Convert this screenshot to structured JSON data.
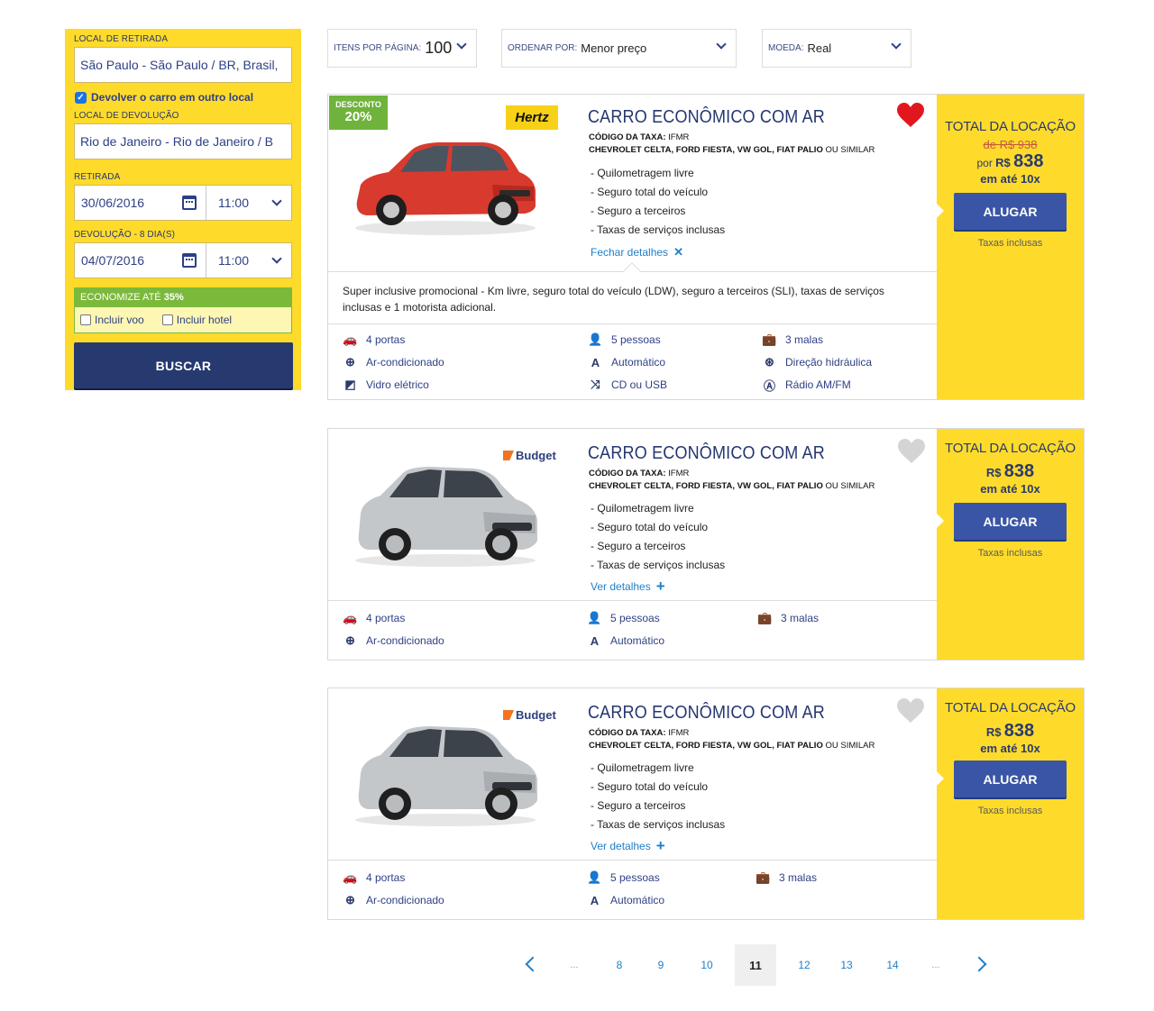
{
  "search": {
    "pickup_label": "LOCAL DE RETIRADA",
    "pickup_value": "São Paulo - São Paulo / BR, Brasil,",
    "return_other_label": "Devolver o carro em outro local",
    "return_label": "LOCAL DE DEVOLUÇÃO",
    "return_value": "Rio de Janeiro - Rio de Janeiro / B",
    "pickup_date_label": "RETIRADA",
    "pickup_date": "30/06/2016",
    "pickup_time": "11:00",
    "return_date_label": "DEVOLUÇÃO - 8 DIA(S)",
    "return_date": "04/07/2016",
    "return_time": "11:00",
    "economize_prefix": "ECONOMIZE ATÉ ",
    "economize_pct": "35%",
    "incluir_voo": "Incluir voo",
    "incluir_hotel": "Incluir hotel",
    "search_button": "BUSCAR"
  },
  "toolbar": {
    "per_page_label": "ITENS POR PÁGINA:",
    "per_page_value": "100",
    "sort_label": "ORDENAR POR:",
    "sort_value": "Menor preço",
    "currency_label": "MOEDA:",
    "currency_value": "Real"
  },
  "results": [
    {
      "company": "Hertz",
      "discount_label": "DESCONTO",
      "discount_value": "20%",
      "favorite": true,
      "title": "CARRO ECONÔMICO COM AR",
      "code_label": "CÓDIGO DA TAXA:",
      "code_value": "IFMR",
      "models": "CHEVROLET CELTA, FORD FIESTA, VW GOL, FIAT PALIO",
      "models_suffix": "OU SIMILAR",
      "features": [
        "- Quilometragem livre",
        "- Seguro total do veículo",
        "- Seguro a terceiros",
        "- Taxas de serviços inclusas"
      ],
      "details_link": "Fechar detalhes",
      "details_text": "Super inclusive promocional - Km livre, seguro total do veículo (LDW), seguro a terceiros (SLI), taxas de serviços inclusas e 1 motorista adicional.",
      "specs": [
        "4 portas",
        "5 pessoas",
        "3 malas",
        "Ar-condicionado",
        "Automático",
        "Direção hidráulica",
        "Vidro elétrico",
        "CD ou USB",
        "Rádio AM/FM"
      ],
      "price_title": "TOTAL DA LOCAÇÃO",
      "old_price": "de R$ 938",
      "price_prefix": "por",
      "currency": "R$",
      "price": "838",
      "installments": "em até 10x",
      "rent_button": "ALUGAR",
      "taxes_note": "Taxas inclusas"
    },
    {
      "company": "Budget",
      "favorite": false,
      "title": "CARRO ECONÔMICO COM AR",
      "code_label": "CÓDIGO DA TAXA:",
      "code_value": "IFMR",
      "models": "CHEVROLET CELTA, FORD FIESTA, VW GOL, FIAT PALIO",
      "models_suffix": "OU SIMILAR",
      "features": [
        "- Quilometragem livre",
        "- Seguro total do veículo",
        "- Seguro a terceiros",
        "- Taxas de serviços inclusas"
      ],
      "details_link": "Ver detalhes",
      "specs": [
        "4 portas",
        "5 pessoas",
        "3 malas",
        "Ar-condicionado",
        "Automático"
      ],
      "price_title": "TOTAL DA LOCAÇÃO",
      "currency": "R$",
      "price": "838",
      "installments": "em até 10x",
      "rent_button": "ALUGAR",
      "taxes_note": "Taxas inclusas"
    },
    {
      "company": "Budget",
      "favorite": false,
      "title": "CARRO ECONÔMICO COM AR",
      "code_label": "CÓDIGO DA TAXA:",
      "code_value": "IFMR",
      "models": "CHEVROLET CELTA, FORD FIESTA, VW GOL, FIAT PALIO",
      "models_suffix": "OU SIMILAR",
      "features": [
        "- Quilometragem livre",
        "- Seguro total do veículo",
        "- Seguro a terceiros",
        "- Taxas de serviços inclusas"
      ],
      "details_link": "Ver detalhes",
      "specs": [
        "4 portas",
        "5 pessoas",
        "3 malas",
        "Ar-condicionado",
        "Automático"
      ],
      "price_title": "TOTAL DA LOCAÇÃO",
      "currency": "R$",
      "price": "838",
      "installments": "em até 10x",
      "rent_button": "ALUGAR",
      "taxes_note": "Taxas inclusas"
    }
  ],
  "pagination": {
    "pages": [
      "...",
      "8",
      "9",
      "10",
      "11",
      "12",
      "13",
      "14",
      "..."
    ],
    "current": "11"
  },
  "colors": {
    "accent_yellow": "#fedb2b",
    "navy": "#263a70",
    "button_blue": "#3a55a6",
    "discount_green": "#6fb33c",
    "link_blue": "#1e7fc8",
    "favorite_red": "#e2171d"
  }
}
